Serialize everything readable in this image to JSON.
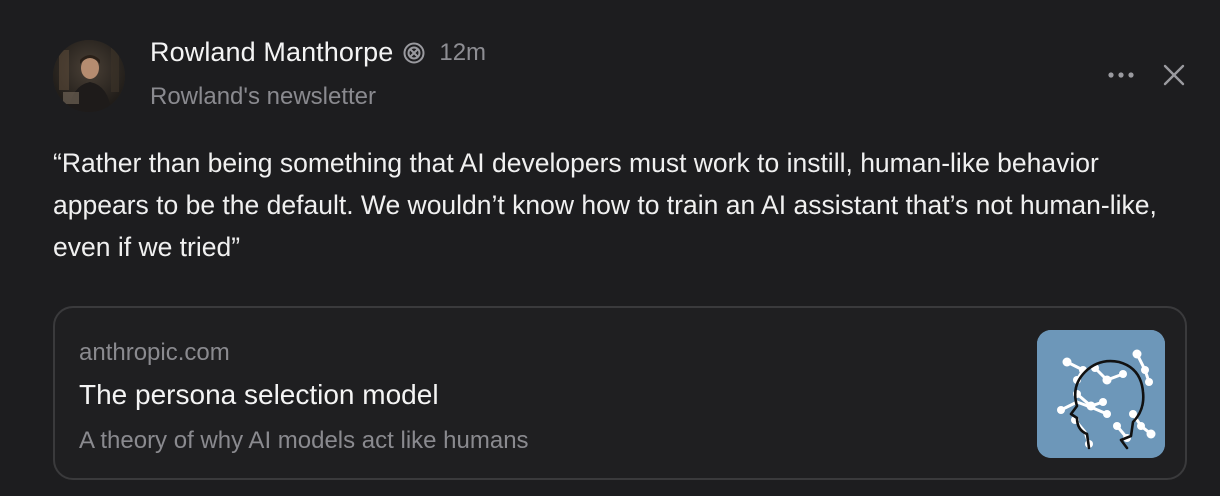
{
  "post": {
    "author_name": "Rowland Manthorpe",
    "timestamp": "12m",
    "publication": "Rowland's newsletter",
    "body": "“Rather than being something that AI developers must work to instill, human-like behavior appears to be the default. We wouldn’t know how to train an AI assistant that’s not human-like, even if we tried”",
    "icons": {
      "verified": "verified-badge-icon",
      "more": "more-horizontal-icon",
      "close": "close-icon"
    }
  },
  "link_card": {
    "domain": "anthropic.com",
    "title": "The persona selection model",
    "subtitle": "A theory of why AI models act like humans",
    "thumbnail": "head-network-illustration",
    "thumbnail_color": "#6d97b9"
  },
  "colors": {
    "background": "#1d1d1f",
    "text_primary": "#f2f2f2",
    "text_secondary": "#8a8a8f",
    "card_border": "#3a3a3c"
  }
}
